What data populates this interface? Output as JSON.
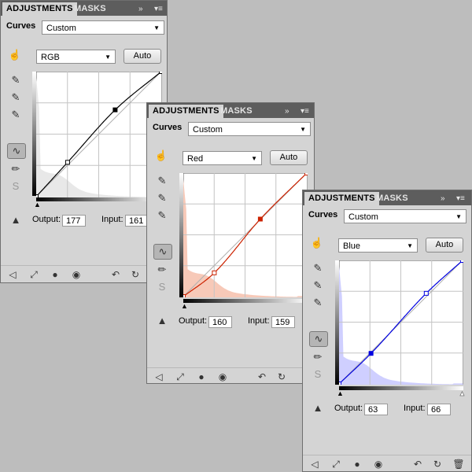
{
  "panels": [
    {
      "id": "rgb",
      "tabs": {
        "active": "ADJUSTMENTS",
        "inactive": "MASKS"
      },
      "tab_icons": {
        "collapse": "»",
        "menu": "▾≡"
      },
      "type_label": "Curves",
      "preset": "Custom",
      "channel": "RGB",
      "auto_label": "Auto",
      "output_label": "Output:",
      "output_value": "177",
      "input_label": "Input:",
      "input_value": "161",
      "curve_color": "#000000",
      "hist_color": "#e8e8e8",
      "curve_points": [
        [
          0,
          0
        ],
        [
          64,
          70
        ],
        [
          161,
          177
        ],
        [
          255,
          255
        ]
      ],
      "histogram_peak_near_zero": true
    },
    {
      "id": "red",
      "tabs": {
        "active": "ADJUSTMENTS",
        "inactive": "MASKS"
      },
      "tab_icons": {
        "collapse": "»",
        "menu": "▾≡"
      },
      "type_label": "Curves",
      "preset": "Custom",
      "channel": "Red",
      "auto_label": "Auto",
      "output_label": "Output:",
      "output_value": "160",
      "input_label": "Input:",
      "input_value": "159",
      "curve_color": "#cc2200",
      "hist_color": "#f7c9b8",
      "curve_points": [
        [
          0,
          0
        ],
        [
          64,
          49
        ],
        [
          159,
          160
        ],
        [
          255,
          255
        ]
      ],
      "histogram_peak_near_zero": true
    },
    {
      "id": "blue",
      "tabs": {
        "active": "ADJUSTMENTS",
        "inactive": "MASKS"
      },
      "tab_icons": {
        "collapse": "»",
        "menu": "▾≡"
      },
      "type_label": "Curves",
      "preset": "Custom",
      "channel": "Blue",
      "auto_label": "Auto",
      "output_label": "Output:",
      "output_value": "63",
      "input_label": "Input:",
      "input_value": "66",
      "curve_color": "#0000e0",
      "hist_color": "#cfcfff",
      "curve_points": [
        [
          0,
          0
        ],
        [
          66,
          63
        ],
        [
          180,
          187
        ],
        [
          255,
          255
        ]
      ],
      "histogram_peak_near_zero": true
    }
  ],
  "icons": {
    "target_adjust": "☝",
    "eyedropper_black": "✎",
    "eyedropper_gray": "✎",
    "eyedropper_white": "✎",
    "curve_tool": "∿",
    "pencil_tool": "✏",
    "smooth_tool": "S",
    "histogram_warning": "▲",
    "back": "◁",
    "expand": "⤢",
    "clip_layer": "●",
    "visibility": "◉",
    "previous_state": "↶",
    "reset": "↻",
    "delete": "🗑"
  }
}
